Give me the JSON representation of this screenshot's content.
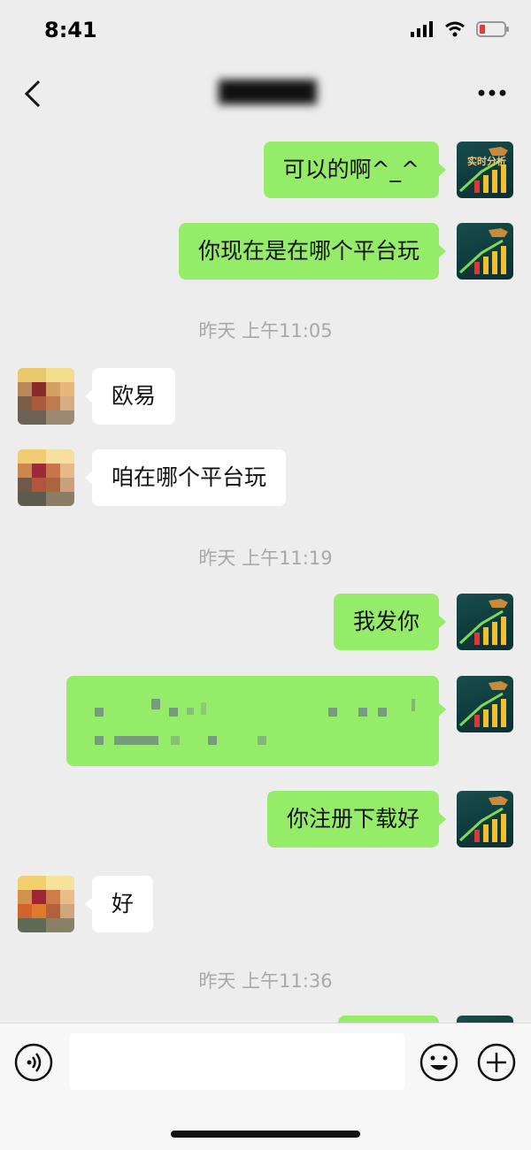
{
  "status_bar": {
    "time": "8:41"
  },
  "chat": {
    "title": "██████"
  },
  "messages": [
    {
      "side": "right",
      "text": "可以的啊^_^"
    },
    {
      "side": "right",
      "text": "你现在是在哪个平台玩"
    },
    {
      "type": "time",
      "text": "昨天 上午11:05"
    },
    {
      "side": "left",
      "text": "欧易"
    },
    {
      "side": "left",
      "text": "咱在哪个平台玩"
    },
    {
      "type": "time",
      "text": "昨天 上午11:19"
    },
    {
      "side": "right",
      "text": "我发你"
    },
    {
      "side": "right",
      "type": "redacted"
    },
    {
      "side": "right",
      "text": "你注册下载好"
    },
    {
      "side": "left",
      "text": "好"
    },
    {
      "type": "time",
      "text": "昨天 上午11:36"
    }
  ],
  "avatar_right": {
    "label": "实时分析"
  },
  "input": {
    "placeholder": ""
  },
  "colors": {
    "bubble_self": "#95ec69",
    "bubble_other": "#ffffff",
    "background": "#ededed"
  }
}
